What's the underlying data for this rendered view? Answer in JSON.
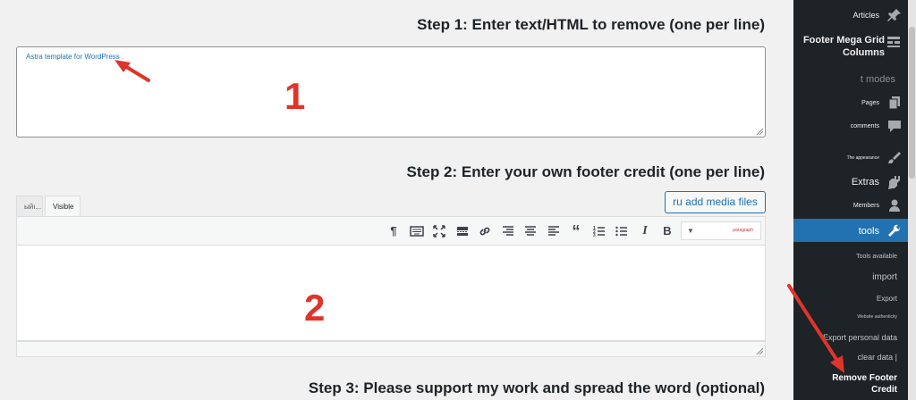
{
  "steps": {
    "step1": "Step 1: Enter text/HTML to remove (one per line)",
    "step2": "Step 2: Enter your own footer credit (one per line)",
    "step3": "Step 3: Please support my work and spread the word (optional)"
  },
  "remove_field": {
    "value": "Astra template for WordPress ."
  },
  "annotations": {
    "num1": "1",
    "num2": "2"
  },
  "editor": {
    "tab_html": "ыйı...",
    "tab_visual": "Visible",
    "add_media": "ru add media files",
    "format_select": {
      "value": "paragraph"
    },
    "toolbar_icons": [
      "paragraph-icon",
      "keyboard-icon",
      "fullscreen-icon",
      "insert-more-icon",
      "link-icon",
      "align-right-icon",
      "align-center-icon",
      "align-left-icon",
      "blockquote-icon",
      "numbered-list-icon",
      "bullet-list-icon",
      "italic-icon",
      "bold-icon"
    ]
  },
  "sidebar": {
    "articles": "Articles",
    "footer_mega": "Footer Mega Grid Columns",
    "t_modes": "t modes",
    "pages": "Pages",
    "comments": "comments",
    "appearance": "The appearance",
    "extras": "Extras",
    "members": "Members",
    "tools": "tools",
    "tools_available": "Tools available",
    "import": "import",
    "export": "Export",
    "site_health": "Website authenticity",
    "export_personal": "Export personal data",
    "clear_data": "clear data |",
    "remove_footer": "Remove Footer Credit",
    "active_color": "#2271b1",
    "sidebar_color": "#1d2327"
  },
  "colors": {
    "accent": "#2271b1",
    "annotation_red": "#e0342b"
  }
}
